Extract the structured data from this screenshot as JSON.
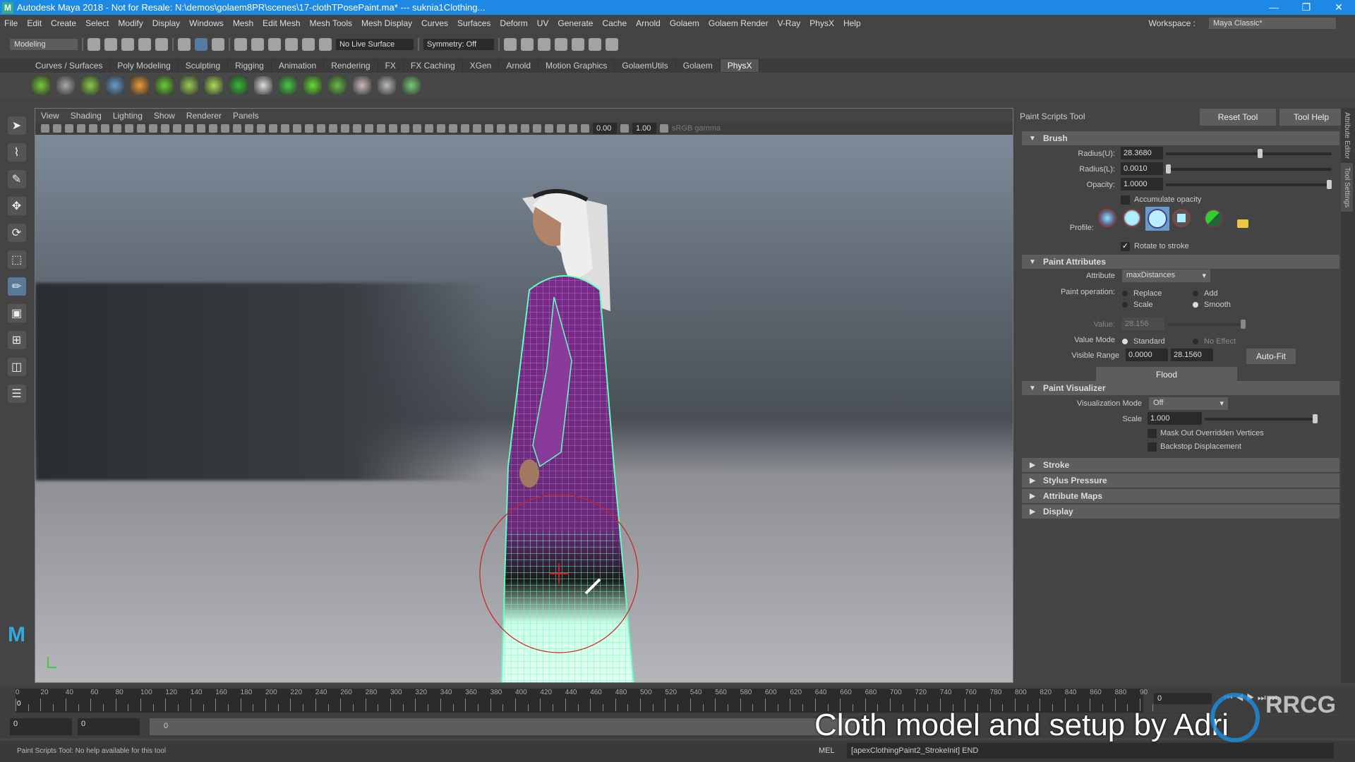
{
  "window": {
    "title": "Autodesk Maya 2018 - Not for Resale: N:\\demos\\golaem8PR\\scenes\\17-clothTPosePaint.ma*   ---   suknia1Clothing...",
    "logo": "M",
    "controls": [
      "—",
      "❐",
      "✕"
    ]
  },
  "menubar": {
    "items": [
      "File",
      "Edit",
      "Create",
      "Select",
      "Modify",
      "Display",
      "Windows",
      "Mesh",
      "Edit Mesh",
      "Mesh Tools",
      "Mesh Display",
      "Curves",
      "Surfaces",
      "Deform",
      "UV",
      "Generate",
      "Cache",
      "Arnold",
      "Golaem",
      "Golaem Render",
      "V-Ray",
      "PhysX",
      "Help"
    ],
    "workspace_label": "Workspace :",
    "workspace_value": "Maya Classic*"
  },
  "toolbar": {
    "mode": "Modeling",
    "live_surface": "No Live Surface",
    "symmetry": "Symmetry: Off"
  },
  "shelf": {
    "tabs": [
      "Curves / Surfaces",
      "Poly Modeling",
      "Sculpting",
      "Rigging",
      "Animation",
      "Rendering",
      "FX",
      "FX Caching",
      "XGen",
      "Arnold",
      "Motion Graphics",
      "GolaemUtils",
      "Golaem",
      "PhysX"
    ],
    "active_tab": "PhysX",
    "icon_colors": [
      "#7c3",
      "#aaa",
      "#8c4",
      "#69c",
      "#e93",
      "#6c3",
      "#9c5",
      "#ad5",
      "#3b3",
      "#ddd",
      "#4c4",
      "#6d3",
      "#6b4",
      "#cbb",
      "#bbb",
      "#7c7"
    ]
  },
  "viewport": {
    "menus": [
      "View",
      "Shading",
      "Lighting",
      "Show",
      "Renderer",
      "Panels"
    ],
    "exposure": "0.00",
    "gamma": "1.00",
    "color_space": "sRGB gamma",
    "accent_wire": "#5fffc0",
    "robe_color": "#7a2a8a",
    "brush_color": "#d02020"
  },
  "tool_settings": {
    "title": "Paint Scripts Tool",
    "reset": "Reset Tool",
    "help": "Tool Help",
    "brush": {
      "header": "Brush",
      "radius_u_label": "Radius(U):",
      "radius_u": "28.3680",
      "radius_u_frac": 0.57,
      "radius_l_label": "Radius(L):",
      "radius_l": "0.0010",
      "radius_l_frac": 0.0,
      "opacity_label": "Opacity:",
      "opacity": "1.0000",
      "opacity_frac": 1.0,
      "accumulate": "Accumulate opacity",
      "accumulate_checked": false,
      "profile_label": "Profile:",
      "rotate": "Rotate to stroke",
      "rotate_checked": true
    },
    "paint_attributes": {
      "header": "Paint Attributes",
      "attribute_label": "Attribute",
      "attribute": "maxDistances",
      "operation_label": "Paint operation:",
      "ops": [
        "Replace",
        "Add",
        "Scale",
        "Smooth"
      ],
      "selected_op": "Smooth",
      "value_label": "Value:",
      "value": "28.156",
      "value_mode_label": "Value Mode",
      "modes": [
        "Standard",
        "No Effect"
      ],
      "selected_mode": "Standard",
      "range_label": "Visible Range",
      "range_min": "0.0000",
      "range_max": "28.1560",
      "autofit": "Auto-Fit",
      "flood": "Flood"
    },
    "visualizer": {
      "header": "Paint Visualizer",
      "mode_label": "Visualization Mode",
      "mode": "Off",
      "scale_label": "Scale",
      "scale": "1.000",
      "mask": "Mask Out Overridden Vertices",
      "backstop": "Backstop Displacement"
    },
    "collapsed": [
      "Stroke",
      "Stylus Pressure",
      "Attribute Maps",
      "Display"
    ]
  },
  "side_tabs": [
    "Attribute Editor",
    "Tool Settings"
  ],
  "timeline": {
    "ticks": [
      "0",
      "20",
      "40",
      "60",
      "80",
      "100",
      "120",
      "140",
      "160",
      "180",
      "200",
      "220",
      "240",
      "260",
      "280",
      "300",
      "320",
      "340",
      "360",
      "380",
      "400",
      "420",
      "440",
      "460",
      "480",
      "500",
      "520",
      "540",
      "560",
      "580",
      "600",
      "620",
      "640",
      "660",
      "680",
      "700",
      "720",
      "740",
      "760",
      "780",
      "800",
      "820",
      "840",
      "860",
      "880",
      "90"
    ],
    "current": "0",
    "current_field": "0"
  },
  "range": {
    "start": "0",
    "inner_start": "0",
    "slider_start": "0"
  },
  "status": {
    "help": "Paint Scripts Tool: No help available for this tool",
    "cmd_type": "MEL",
    "cmd_output": "[apexClothingPaint2_StrokeInit] END"
  },
  "overlay": {
    "subtitle": "Cloth model and setup by Adri",
    "watermark": "RRCG 人人素材"
  }
}
